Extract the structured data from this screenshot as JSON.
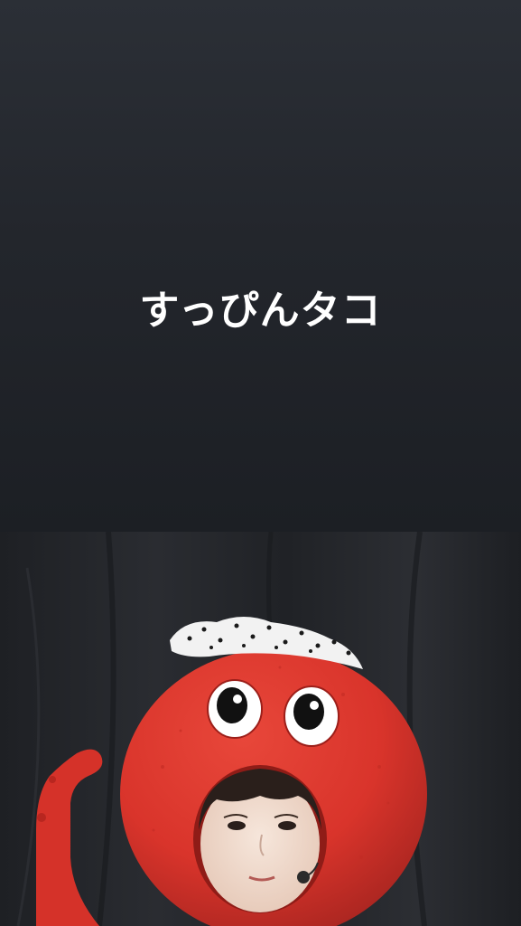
{
  "story": {
    "caption": "すっぴんタコ"
  },
  "photo": {
    "subject": "person-in-red-octopus-costume",
    "colors": {
      "background_cloth": "#23252a",
      "octopus_red": "#d9342b",
      "octopus_shadow": "#a82520",
      "headband": "#f2f2f2",
      "eye_white": "#ffffff",
      "pupil": "#111111",
      "skin": "#f1ddd0",
      "hair": "#2a1f1b"
    }
  }
}
